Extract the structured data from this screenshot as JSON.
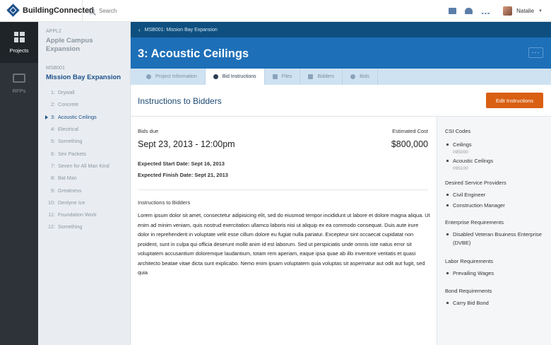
{
  "topbar": {
    "brand": "BuildingConnected",
    "search_placeholder": "Search",
    "user_name": "Natalie"
  },
  "rail": {
    "items": [
      {
        "label": "Projects",
        "icon": "grid-icon"
      },
      {
        "label": "RFPs",
        "icon": "inbox-icon"
      }
    ]
  },
  "nav": {
    "projects": [
      {
        "code": "APPL2",
        "name": "Apple Campus Expansion"
      },
      {
        "code": "MSB001",
        "name": "Mission Bay Expansion"
      }
    ],
    "items": [
      {
        "num": "1:",
        "label": "Drywall"
      },
      {
        "num": "2:",
        "label": "Concrete"
      },
      {
        "num": "3:",
        "label": "Acoustic Ceilings"
      },
      {
        "num": "4:",
        "label": "Electrical"
      },
      {
        "num": "5:",
        "label": "Something"
      },
      {
        "num": "6:",
        "label": "Sex Packets"
      },
      {
        "num": "7:",
        "label": "Seven for All Man Kind"
      },
      {
        "num": "8:",
        "label": "Bat Man"
      },
      {
        "num": "9:",
        "label": "Greatness"
      },
      {
        "num": "10:",
        "label": "Dentyne Ice"
      },
      {
        "num": "11:",
        "label": "Foundation Work"
      },
      {
        "num": "12:",
        "label": "Something"
      }
    ]
  },
  "header": {
    "breadcrumb": "MSB001: Mission Bay Expansion",
    "title": "3: Acoustic Ceilings",
    "more": "···",
    "tabs": [
      "Project Information",
      "Bid Instructions",
      "Files",
      "Bidders",
      "Bids"
    ]
  },
  "section": {
    "title": "Instructions to Bidders",
    "edit_label": "Edit Instructions"
  },
  "bid": {
    "due_label": "Bids due",
    "due_value": "Sept 23, 2013 - 12:00pm",
    "cost_label": "Estimated Cost",
    "cost_value": "$800,000",
    "start": "Expected Start Date: Sept 16, 2013",
    "finish": "Expected Finish Date: Sept 21, 2013",
    "instructions_label": "Instructions to Bidders",
    "instructions_text": "Lorem ipsum dolor sit amet, consectetur adipisicing elit, sed do eiusmod tempor incididunt ut labore et dolore magna aliqua. Ut enim ad minim veniam, quis nostrud exercitation ullamco laboris nisi ut aliquip ex ea commodo consequat. Duis aute irure dolor in reprehenderit in voluptate velit esse cillum dolore eu fugiat nulla pariatur. Excepteur sint occaecat cupidatat non proident, sunt in culpa qui officia deserunt mollit anim id est laborum. Sed ut perspiciatis unde omnis iste natus error sit voluptatem accusantium doloremque laudantium, totam rem aperiam, eaque ipsa quae ab illo inventore veritatis et quasi architecto beatae vitae dicta sunt explicabo. Nemo enim ipsam voluptatem quia voluptas sit aspernatur aut odit aut fugit, sed quia"
  },
  "sidebar": {
    "csi_title": "CSI Codes",
    "csi": [
      {
        "name": "Ceilings",
        "code": "095000"
      },
      {
        "name": "Acoustic Ceilings",
        "code": "095100"
      }
    ],
    "providers_title": "Desired Service Providers",
    "providers": [
      "Civil Engineer",
      "Construction Manager"
    ],
    "enterprise_title": "Enterprise Requirements",
    "enterprise": [
      "Disabled Veteran Bsuiness Enterprise (DVBE)"
    ],
    "labor_title": "Labor Requirements",
    "labor": [
      "Prevailing Wages"
    ],
    "bond_title": "Bond Requirements",
    "bond": [
      "Carry Bid Bond"
    ]
  },
  "colors": {
    "header_blue": "#1d6fb8",
    "breadcrumb_navy": "#0e4f7f",
    "accent_orange": "#d95f13",
    "rail_dark": "#2d3339"
  }
}
